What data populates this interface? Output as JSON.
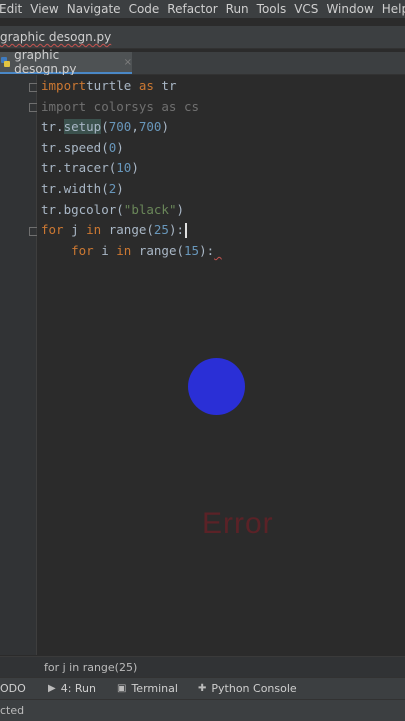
{
  "menu": [
    "Edit",
    "View",
    "Navigate",
    "Code",
    "Refactor",
    "Run",
    "Tools",
    "VCS",
    "Window",
    "Help"
  ],
  "nav": {
    "file": "graphic desogn.py"
  },
  "tab": {
    "label": "graphic desogn.py",
    "close": "×"
  },
  "code": [
    {
      "parts": [
        [
          "kw",
          "import"
        ],
        [
          "",
          "turtle "
        ],
        [
          "kw",
          "as"
        ],
        [
          "",
          " tr"
        ]
      ]
    },
    {
      "parts": [
        [
          "dim",
          "import colorsys as cs"
        ]
      ]
    },
    {
      "parts": [
        [
          "",
          "tr."
        ],
        [
          "hl",
          "setup"
        ],
        [
          "",
          "("
        ],
        [
          "num",
          "700"
        ],
        [
          "",
          ","
        ],
        [
          "num",
          "700"
        ],
        [
          "",
          ")"
        ]
      ]
    },
    {
      "parts": [
        [
          "",
          "tr.speed("
        ],
        [
          "num",
          "0"
        ],
        [
          "",
          ")"
        ]
      ]
    },
    {
      "parts": [
        [
          "",
          "tr.tracer("
        ],
        [
          "num",
          "10"
        ],
        [
          "",
          ")"
        ]
      ]
    },
    {
      "parts": [
        [
          "",
          "tr.width("
        ],
        [
          "num",
          "2"
        ],
        [
          "",
          ")"
        ]
      ]
    },
    {
      "parts": [
        [
          "",
          "tr.bgcolor("
        ],
        [
          "str",
          "\"black\""
        ],
        [
          "",
          ")"
        ]
      ]
    },
    {
      "parts": [
        [
          "kw",
          "for"
        ],
        [
          "",
          " j "
        ],
        [
          "kw",
          "in"
        ],
        [
          "",
          " range("
        ],
        [
          "num",
          "25"
        ],
        [
          "",
          "):"
        ]
      ]
    },
    {
      "parts": [
        [
          "",
          "    "
        ],
        [
          "kw",
          "for"
        ],
        [
          "",
          " i "
        ],
        [
          "kw",
          "in"
        ],
        [
          "",
          " range("
        ],
        [
          "num",
          "15"
        ],
        [
          "",
          "):"
        ]
      ]
    }
  ],
  "overlay": {
    "error_text": "Error",
    "ball_color": "#2a2fd6"
  },
  "breadcrumb": "for j in range(25)",
  "toolwindows": {
    "todo": "ODO",
    "run": "4: Run",
    "terminal": "Terminal",
    "python_console": "Python Console"
  },
  "status": {
    "text": "cted"
  },
  "colors": {
    "keyword": "#cc7832",
    "number": "#6897bb",
    "string": "#6a8759",
    "text": "#a9b7c6",
    "background": "#2b2b2b"
  }
}
